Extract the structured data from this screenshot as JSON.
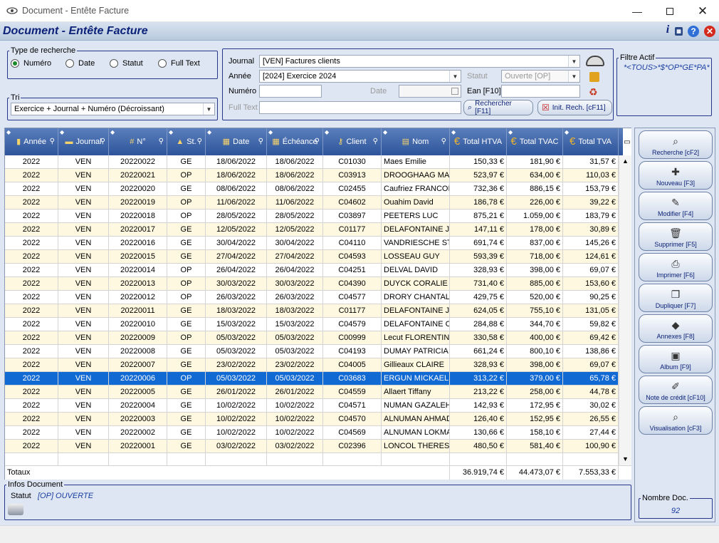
{
  "window": {
    "title": "Document - Entête Facture"
  },
  "header": {
    "title": "Document - Entête Facture"
  },
  "search_type": {
    "legend": "Type de recherche",
    "options": [
      "Numéro",
      "Date",
      "Statut",
      "Full Text"
    ],
    "selected": "Numéro"
  },
  "sort": {
    "legend": "Tri",
    "value": "Exercice + Journal + Numéro (Décroissant)"
  },
  "filters": {
    "journal_label": "Journal",
    "journal_value": "[VEN] Factures clients",
    "annee_label": "Année",
    "annee_value": "[2024] Exercice 2024",
    "statut_label": "Statut",
    "statut_value": "Ouverte [OP]",
    "numero_label": "Numéro",
    "date_label": "Date",
    "ean_label": "Ean [F10]",
    "fulltext_label": "Full Text",
    "search_button": "Rechercher [F11]",
    "reset_button": "Init. Rech. [cF11]"
  },
  "active_filter": {
    "legend": "Filtre Actif",
    "value": "*<TOUS>*$*OP*GE*PA*"
  },
  "grid": {
    "columns": [
      "Année",
      "Journal",
      "N°",
      "St.",
      "Date",
      "Échéance",
      "Client",
      "Nom",
      "Total HTVA",
      "Total TVAC",
      "Total TVA"
    ],
    "rows": [
      [
        "2022",
        "VEN",
        "20220022",
        "GE",
        "18/06/2022",
        "18/06/2022",
        "C01030",
        "Maes Emilie",
        "150,33 €",
        "181,90 €",
        "31,57 €"
      ],
      [
        "2022",
        "VEN",
        "20220021",
        "OP",
        "18/06/2022",
        "18/06/2022",
        "C03913",
        "DROOGHAAG MAR",
        "523,97 €",
        "634,00 €",
        "110,03 €"
      ],
      [
        "2022",
        "VEN",
        "20220020",
        "GE",
        "08/06/2022",
        "08/06/2022",
        "C02455",
        "Caufriez FRANCOIS",
        "732,36 €",
        "886,15 €",
        "153,79 €"
      ],
      [
        "2022",
        "VEN",
        "20220019",
        "OP",
        "11/06/2022",
        "11/06/2022",
        "C04602",
        "Ouahim David",
        "186,78 €",
        "226,00 €",
        "39,22 €"
      ],
      [
        "2022",
        "VEN",
        "20220018",
        "OP",
        "28/05/2022",
        "28/05/2022",
        "C03897",
        "PEETERS LUC",
        "875,21 €",
        "1.059,00 €",
        "183,79 €"
      ],
      [
        "2022",
        "VEN",
        "20220017",
        "GE",
        "12/05/2022",
        "12/05/2022",
        "C01177",
        "DELAFONTAINE JEA",
        "147,11 €",
        "178,00 €",
        "30,89 €"
      ],
      [
        "2022",
        "VEN",
        "20220016",
        "GE",
        "30/04/2022",
        "30/04/2022",
        "C04110",
        "VANDRIESCHE STE",
        "691,74 €",
        "837,00 €",
        "145,26 €"
      ],
      [
        "2022",
        "VEN",
        "20220015",
        "GE",
        "27/04/2022",
        "27/04/2022",
        "C04593",
        "LOSSEAU GUY",
        "593,39 €",
        "718,00 €",
        "124,61 €"
      ],
      [
        "2022",
        "VEN",
        "20220014",
        "OP",
        "26/04/2022",
        "26/04/2022",
        "C04251",
        "DELVAL DAVID",
        "328,93 €",
        "398,00 €",
        "69,07 €"
      ],
      [
        "2022",
        "VEN",
        "20220013",
        "OP",
        "30/03/2022",
        "30/03/2022",
        "C04390",
        "DUYCK CORALIE",
        "731,40 €",
        "885,00 €",
        "153,60 €"
      ],
      [
        "2022",
        "VEN",
        "20220012",
        "OP",
        "26/03/2022",
        "26/03/2022",
        "C04577",
        "DRORY CHANTAL",
        "429,75 €",
        "520,00 €",
        "90,25 €"
      ],
      [
        "2022",
        "VEN",
        "20220011",
        "GE",
        "18/03/2022",
        "18/03/2022",
        "C01177",
        "DELAFONTAINE JEA",
        "624,05 €",
        "755,10 €",
        "131,05 €"
      ],
      [
        "2022",
        "VEN",
        "20220010",
        "GE",
        "15/03/2022",
        "15/03/2022",
        "C04579",
        "DELAFONTAINE CA",
        "284,88 €",
        "344,70 €",
        "59,82 €"
      ],
      [
        "2022",
        "VEN",
        "20220009",
        "OP",
        "05/03/2022",
        "05/03/2022",
        "C00999",
        "Lecut FLORENTIN",
        "330,58 €",
        "400,00 €",
        "69,42 €"
      ],
      [
        "2022",
        "VEN",
        "20220008",
        "GE",
        "05/03/2022",
        "05/03/2022",
        "C04193",
        "DUMAY PATRICIA",
        "661,24 €",
        "800,10 €",
        "138,86 €"
      ],
      [
        "2022",
        "VEN",
        "20220007",
        "GE",
        "23/02/2022",
        "23/02/2022",
        "C04005",
        "Gillieaux CLAIRE",
        "328,93 €",
        "398,00 €",
        "69,07 €"
      ],
      [
        "2022",
        "VEN",
        "20220006",
        "OP",
        "05/03/2022",
        "05/03/2022",
        "C03683",
        "ERGUN MICKAEL",
        "313,22 €",
        "379,00 €",
        "65,78 €"
      ],
      [
        "2022",
        "VEN",
        "20220005",
        "GE",
        "26/01/2022",
        "26/01/2022",
        "C04559",
        "Allaert Tiffany",
        "213,22 €",
        "258,00 €",
        "44,78 €"
      ],
      [
        "2022",
        "VEN",
        "20220004",
        "GE",
        "10/02/2022",
        "10/02/2022",
        "C04571",
        "NUMAN GAZALEH",
        "142,93 €",
        "172,95 €",
        "30,02 €"
      ],
      [
        "2022",
        "VEN",
        "20220003",
        "GE",
        "10/02/2022",
        "10/02/2022",
        "C04570",
        "ALNUMAN AHMAD",
        "126,40 €",
        "152,95 €",
        "26,55 €"
      ],
      [
        "2022",
        "VEN",
        "20220002",
        "GE",
        "10/02/2022",
        "10/02/2022",
        "C04569",
        "ALNUMAN LOKMA",
        "130,66 €",
        "158,10 €",
        "27,44 €"
      ],
      [
        "2022",
        "VEN",
        "20220001",
        "GE",
        "03/02/2022",
        "03/02/2022",
        "C02396",
        "LONCOL THERESE",
        "480,50 €",
        "581,40 €",
        "100,90 €"
      ]
    ],
    "selected_index": 16,
    "totals": {
      "label": "Totaux",
      "htva": "36.919,74 €",
      "tvac": "44.473,07 €",
      "tva": "7.553,33 €"
    }
  },
  "actions": [
    {
      "label": "Recherche [cF2]",
      "icon": "magnifier-icon"
    },
    {
      "label": "Nouveau [F3]",
      "icon": "new-document-icon"
    },
    {
      "label": "Modifier [F4]",
      "icon": "edit-icon"
    },
    {
      "label": "Supprimer [F5]",
      "icon": "trash-icon"
    },
    {
      "label": "Imprimer [F6]",
      "icon": "printer-icon"
    },
    {
      "label": "Dupliquer [F7]",
      "icon": "duplicate-icon"
    },
    {
      "label": "Annexes [F8]",
      "icon": "attachment-icon"
    },
    {
      "label": "Album [F9]",
      "icon": "album-icon"
    },
    {
      "label": "Note de crédit [cF10]",
      "icon": "credit-note-icon"
    },
    {
      "label": "Visualisation [cF3]",
      "icon": "preview-icon"
    }
  ],
  "infos": {
    "legend": "Infos Document",
    "statut_label": "Statut",
    "statut_value": "[OP] OUVERTE"
  },
  "count": {
    "legend": "Nombre Doc.",
    "value": "92"
  }
}
